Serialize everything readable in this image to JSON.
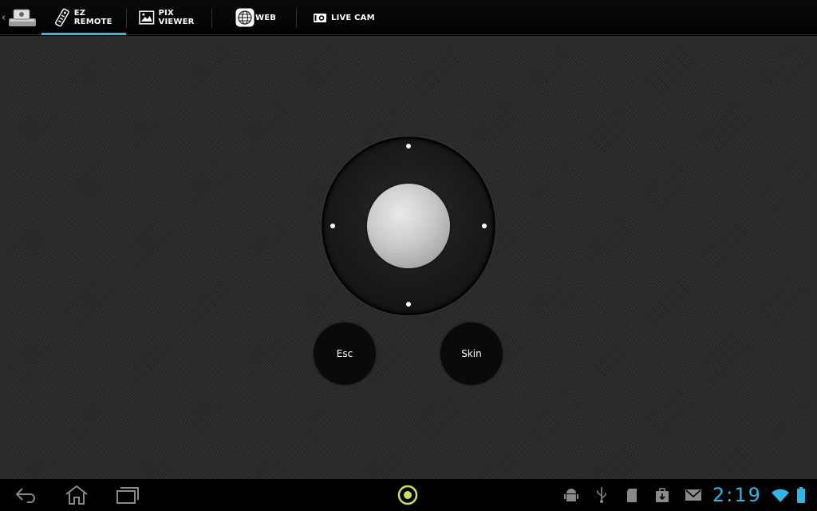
{
  "tabs": [
    {
      "label": "EZ REMOTE",
      "icon": "remote-icon",
      "active": true
    },
    {
      "label": "PIX VIEWER",
      "icon": "picture-icon",
      "active": false
    },
    {
      "label": "WEB",
      "icon": "globe-icon",
      "active": false
    },
    {
      "label": "LIVE CAM",
      "icon": "camera-icon",
      "active": false
    }
  ],
  "remote": {
    "esc_label": "Esc",
    "skin_label": "Skin"
  },
  "status": {
    "clock": "2:19"
  },
  "colors": {
    "accent": "#33b5e5"
  }
}
